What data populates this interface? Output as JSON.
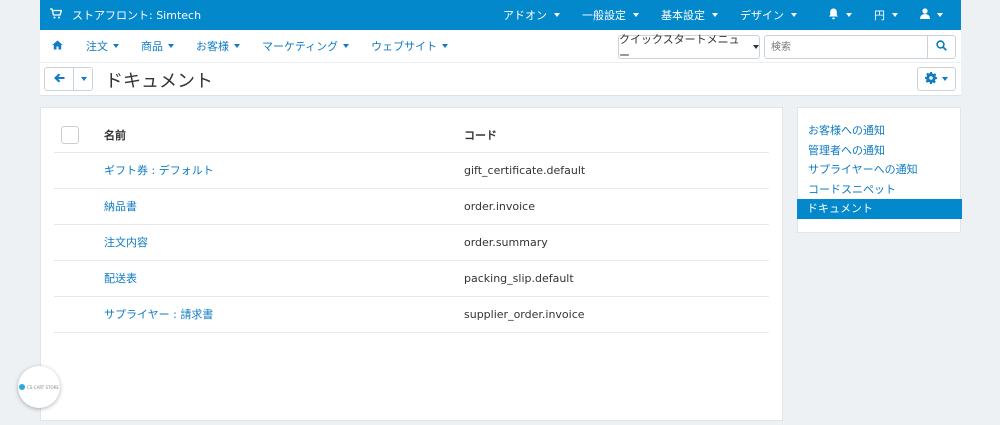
{
  "topbar": {
    "store_title": "ストアフロント: Simtech",
    "menus": [
      "アドオン",
      "一般設定",
      "基本設定",
      "デザイン"
    ],
    "currency": "円"
  },
  "nav": {
    "items": [
      "注文",
      "商品",
      "お客様",
      "マーケティング",
      "ウェブサイト"
    ],
    "quickstart_label": "クイックスタートメニュー",
    "search_placeholder": "検索"
  },
  "page": {
    "title": "ドキュメント"
  },
  "table": {
    "headers": {
      "name": "名前",
      "code": "コード"
    },
    "rows": [
      {
        "name": "ギフト券 : デフォルト",
        "code": "gift_certificate.default"
      },
      {
        "name": "納品書",
        "code": "order.invoice"
      },
      {
        "name": "注文内容",
        "code": "order.summary"
      },
      {
        "name": "配送表",
        "code": "packing_slip.default"
      },
      {
        "name": "サプライヤー : 請求書",
        "code": "supplier_order.invoice"
      }
    ]
  },
  "sidebar": {
    "items": [
      "お客様への通知",
      "管理者への通知",
      "サプライヤーへの通知",
      "コードスニペット",
      "ドキュメント"
    ],
    "active_index": 4
  },
  "badge": {
    "text": "CS-CART STORE"
  },
  "colors": {
    "brand": "#0388cc",
    "link": "#0e7bc3",
    "background": "#eef1f3"
  }
}
